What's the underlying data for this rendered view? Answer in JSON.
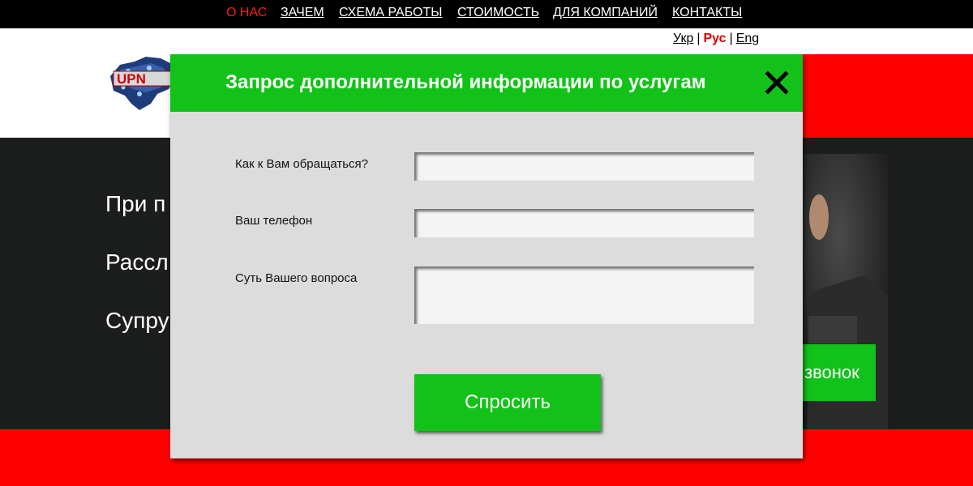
{
  "nav": {
    "items": [
      {
        "label": "О НАС",
        "active": true
      },
      {
        "label": "ЗАЧЕМ",
        "active": false
      },
      {
        "label": "СХЕМА РАБОТЫ",
        "active": false
      },
      {
        "label": "СТОИМОСТЬ",
        "active": false
      },
      {
        "label": "ДЛЯ КОМПАНИЙ",
        "active": false
      },
      {
        "label": "КОНТАКТЫ",
        "active": false
      }
    ]
  },
  "languages": {
    "items": [
      "Укр",
      "Рус",
      "Eng"
    ],
    "current": "Рус",
    "separator": "|"
  },
  "logo": {
    "text": "UPN"
  },
  "hero": {
    "lines": [
      "При п",
      "Рассл",
      "Супру"
    ],
    "callback_label": "звонок"
  },
  "modal": {
    "title": "Запрос дополнительной информации по услугам",
    "fields": {
      "name_label": "Как к Вам обращаться?",
      "phone_label": "Ваш телефон",
      "question_label": "Суть Вашего вопроса"
    },
    "values": {
      "name": "",
      "phone": "",
      "question": ""
    },
    "submit_label": "Спросить",
    "close_icon": "close-icon"
  },
  "colors": {
    "accent_green": "#12c219",
    "brand_red": "#ff0000",
    "nav_black": "#000000",
    "hero_dark": "#1c1d1d",
    "modal_bg": "#dcdcdc",
    "nav_active": "#ff1a1a"
  }
}
